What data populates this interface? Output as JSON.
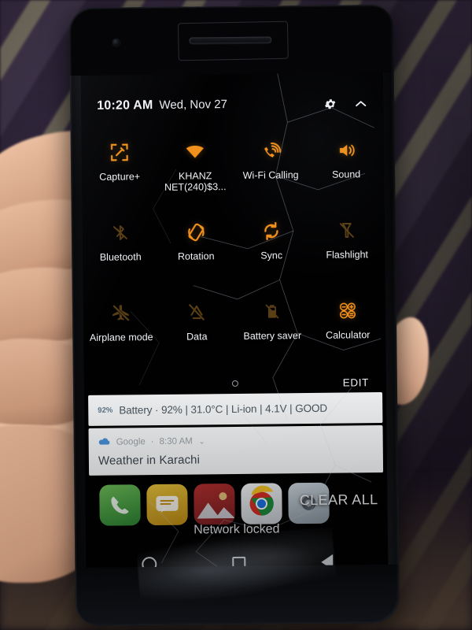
{
  "device": {
    "description": "cracked-smartphone-photo",
    "screen_state": "notification-shade-open"
  },
  "statusbar": {
    "time": "10:20 AM",
    "date": "Wed, Nov 27",
    "settings_icon": "gear-icon",
    "collapse_icon": "chevron-up-icon"
  },
  "quick_settings": {
    "edit_label": "EDIT",
    "accent_on": "#f2911b",
    "accent_off": "#6a4a18",
    "tiles": [
      {
        "label": "Capture+",
        "icon": "capture-plus-icon",
        "state": "on"
      },
      {
        "label": "KHANZ NET(240)$3...",
        "icon": "wifi-icon",
        "state": "on"
      },
      {
        "label": "Wi-Fi Calling",
        "icon": "wifi-calling-icon",
        "state": "on"
      },
      {
        "label": "Sound",
        "icon": "sound-icon",
        "state": "on"
      },
      {
        "label": "Bluetooth",
        "icon": "bluetooth-off-icon",
        "state": "off"
      },
      {
        "label": "Rotation",
        "icon": "rotation-icon",
        "state": "on"
      },
      {
        "label": "Sync",
        "icon": "sync-icon",
        "state": "on"
      },
      {
        "label": "Flashlight",
        "icon": "flashlight-off-icon",
        "state": "off"
      },
      {
        "label": "Airplane mode",
        "icon": "airplane-off-icon",
        "state": "off"
      },
      {
        "label": "Data",
        "icon": "mobile-data-off-icon",
        "state": "off"
      },
      {
        "label": "Battery saver",
        "icon": "battery-saver-off-icon",
        "state": "off"
      },
      {
        "label": "Calculator",
        "icon": "calculator-icon",
        "state": "on"
      }
    ]
  },
  "notifications": [
    {
      "id": "battery",
      "badge": "92%",
      "text": "Battery · 92% | 31.0°C | Li-ion | 4.1V | GOOD"
    },
    {
      "id": "google-weather",
      "app": "Google",
      "separator": "·",
      "time": "8:30 AM",
      "chevron": "⌄",
      "title": "Weather in Karachi",
      "icon": "cloud-icon"
    }
  ],
  "shade": {
    "clear_all_label": "CLEAR ALL"
  },
  "overlay": {
    "network_status": "Network locked"
  },
  "dock": {
    "apps": [
      {
        "name": "Phone",
        "icon": "phone-icon"
      },
      {
        "name": "Messages",
        "icon": "message-icon"
      },
      {
        "name": "Gallery",
        "icon": "gallery-icon"
      },
      {
        "name": "Chrome",
        "icon": "chrome-icon"
      },
      {
        "name": "Settings",
        "icon": "settings-icon"
      }
    ]
  },
  "navbar": {
    "buttons": [
      {
        "name": "Home",
        "icon": "circle-home-icon"
      },
      {
        "name": "Recents",
        "icon": "square-recents-icon"
      },
      {
        "name": "Back",
        "icon": "triangle-back-icon"
      }
    ]
  }
}
